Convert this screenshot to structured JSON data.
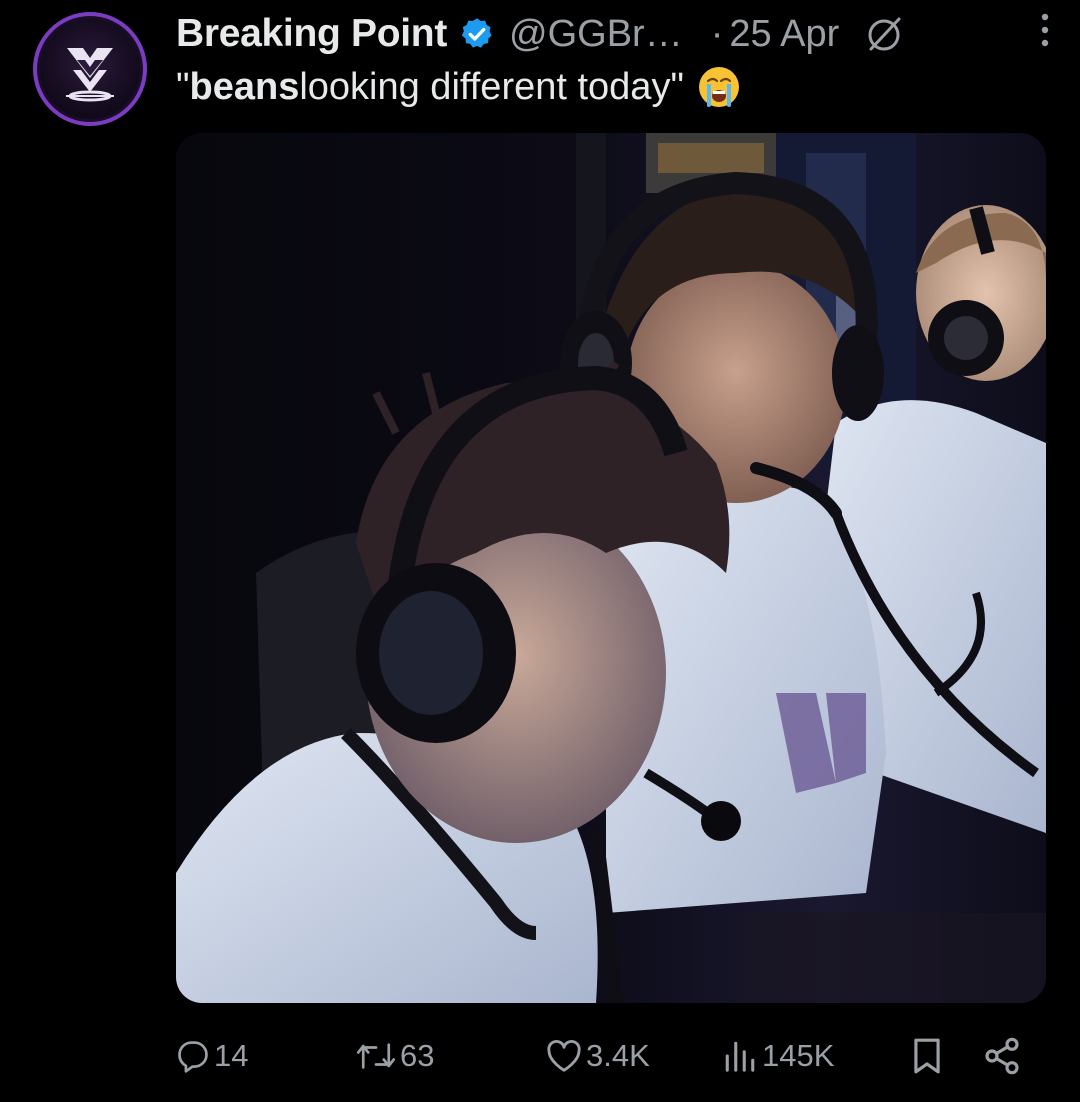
{
  "author": {
    "display_name": "Breaking Point",
    "handle": "@GGBr…",
    "verified": true,
    "avatar_icon": "breaking-point-logo-icon"
  },
  "meta": {
    "separator": "·",
    "date": "25 Apr",
    "edited_icon": "edited-slash-icon",
    "more_icon": "more-vertical-icon"
  },
  "tweet": {
    "quote_open": "\"",
    "bold_word": "beans",
    "rest": " looking different today\"",
    "emoji": "loudly-crying-face-emoji"
  },
  "media": {
    "type": "photo",
    "description_icon": "photo-icon"
  },
  "actions": {
    "replies": "14",
    "retweets": "63",
    "likes": "3.4K",
    "views": "145K",
    "bookmark_icon": "bookmark-icon",
    "share_icon": "share-icon"
  },
  "colors": {
    "background": "#000000",
    "text_primary": "#e7e9ea",
    "text_secondary": "#9aa0a6",
    "verified_blue": "#1d9bf0",
    "avatar_ring": "#7a3cc0"
  }
}
